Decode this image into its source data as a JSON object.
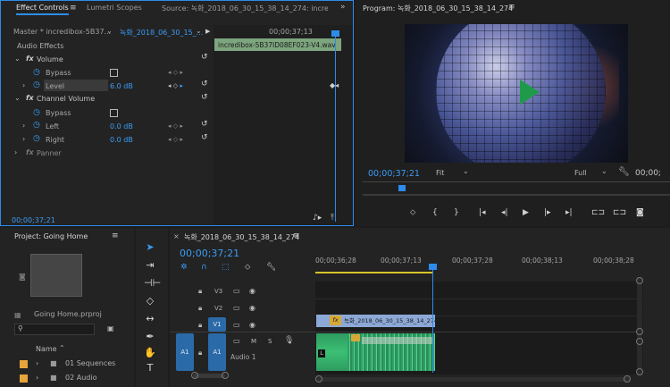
{
  "effect_controls": {
    "tabs": [
      "Effect Controls",
      "Lumetri Scopes",
      "Source: 녹화_2018_06_30_15_38_14_274: incredibox"
    ],
    "master_label": "Master * incredibox-5B37...",
    "clip_label": "녹화_2018_06_30_15_...",
    "ruler_time": "00;00;37;13",
    "clip_name": "incredibox-5B37ID08EF023-V4.wav",
    "section_audio_effects": "Audio Effects",
    "volume": "Volume",
    "bypass": "Bypass",
    "level": "Level",
    "level_value": "6.0 dB",
    "channel_volume": "Channel Volume",
    "left": "Left",
    "left_value": "0.0 dB",
    "right": "Right",
    "right_value": "0.0 dB",
    "panner": "Panner",
    "timecode": "00;00;37;21",
    "fx": "fx"
  },
  "program": {
    "title": "Program: 녹화_2018_06_30_15_38_14_274",
    "timecode": "00;00;37;21",
    "fit": "Fit",
    "quality": "Full",
    "end_timecode": "00;00;",
    "colors": {
      "accent": "#2d8ceb",
      "play": "#1f9a4a"
    }
  },
  "project": {
    "title": "Project: Going Home",
    "file_name": "Going Home.prproj",
    "name_header": "Name",
    "items": [
      "01 Sequences",
      "02 Audio"
    ]
  },
  "timeline": {
    "sequence_name": "녹화_2018_06_30_15_38_14_274",
    "timecode": "00;00;37;21",
    "ruler": [
      "00;00;36;28",
      "00;00;37;13",
      "00;00;37;28",
      "00;00;38;13",
      "00;00;38;28"
    ],
    "tracks": [
      "V3",
      "V2",
      "V1"
    ],
    "a1": "A1",
    "audio_track_name": "Audio 1",
    "m": "M",
    "s": "S",
    "clip_video_label": "녹화_2018_06_30_15_38_14_274",
    "fx": "fx",
    "audio_clip_letter": "L"
  }
}
